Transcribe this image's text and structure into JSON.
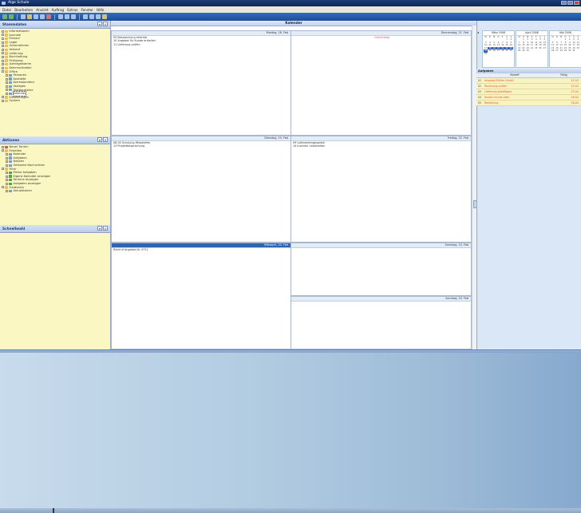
{
  "window": {
    "title": "Alge Schule"
  },
  "menu": [
    "Datei",
    "Bearbeiten",
    "Ansicht",
    "Auftrag",
    "Extras",
    "Fenster",
    "Hilfe"
  ],
  "panels": {
    "navigation": {
      "title": "Stammdaten",
      "items": [
        {
          "label": "Informationen",
          "level": 0,
          "icon": "folder"
        },
        {
          "label": "Journale",
          "level": 0,
          "icon": "folder"
        },
        {
          "label": "Einkauf",
          "level": 0,
          "icon": "folder"
        },
        {
          "label": "Lager",
          "level": 0,
          "icon": "folder"
        },
        {
          "label": "Unternehmen",
          "level": 0,
          "icon": "folder"
        },
        {
          "label": "Verkauf",
          "level": 0,
          "icon": "folder"
        },
        {
          "label": "Lieferung",
          "level": 0,
          "icon": "folder"
        },
        {
          "label": "Buchhaltung",
          "level": 0,
          "icon": "folder"
        },
        {
          "label": "Fertigung",
          "level": 0,
          "icon": "folder"
        },
        {
          "label": "Auftragsstamm",
          "level": 0,
          "icon": "folder"
        },
        {
          "label": "Kommunikation",
          "level": 0,
          "icon": "folder"
        },
        {
          "label": "Office",
          "level": 0,
          "icon": "folder"
        },
        {
          "label": "Personen",
          "level": 1,
          "icon": "doc"
        },
        {
          "label": "Kontakte",
          "level": 1,
          "icon": "doc"
        },
        {
          "label": "Korrespondenz",
          "level": 1,
          "icon": "doc"
        },
        {
          "label": "Vorlagen",
          "level": 1,
          "icon": "doc"
        },
        {
          "label": "Textbausteine",
          "level": 1,
          "icon": "doc"
        },
        {
          "label": "Kalender",
          "level": 1,
          "icon": "doc",
          "selected": true
        },
        {
          "label": "Einstellungen",
          "level": 0,
          "icon": "folder"
        },
        {
          "label": "System",
          "level": 0,
          "icon": "folder"
        }
      ]
    },
    "actions": {
      "title": "Aktionen",
      "items": [
        {
          "label": "Neuer Termin",
          "level": 0,
          "icon": "red"
        },
        {
          "label": "Erstellen",
          "level": 0,
          "icon": "folder"
        },
        {
          "label": "Kalender",
          "level": 1,
          "icon": "doc"
        },
        {
          "label": "Aufgaben",
          "level": 1,
          "icon": "doc"
        },
        {
          "label": "Notizen",
          "level": 1,
          "icon": "doc"
        },
        {
          "label": "Gelesene Nachrichten",
          "level": 1,
          "icon": "doc"
        },
        {
          "label": "Filter",
          "level": 0,
          "icon": "folder"
        },
        {
          "label": "Meine Aufgaben",
          "level": 1,
          "icon": "grn"
        },
        {
          "label": "Eigene Kalender anzeigen",
          "level": 1,
          "icon": "grn"
        },
        {
          "label": "Termine anzeigen",
          "level": 1,
          "icon": "grn"
        },
        {
          "label": "Aufgaben anzeigen",
          "level": 1,
          "icon": "grn"
        },
        {
          "label": "Zusätzlich",
          "level": 0,
          "icon": "folder"
        },
        {
          "label": "Aktualisieren",
          "level": 1,
          "icon": "doc"
        }
      ]
    },
    "shortcuts": {
      "title": "Schnellwahl"
    }
  },
  "calendar": {
    "title": "Kalender",
    "days": [
      {
        "label": "Montag, 18. Feb",
        "entries": [
          "09 Besprechung Vertrieb",
          "10 Angebot für Kunde erstellen",
          "11 Lieferung prüfen"
        ],
        "today": false
      },
      {
        "label": "Donnerstag, 21. Feb",
        "entries": [
          "Geburtstag"
        ],
        "red": true,
        "today": false
      },
      {
        "label": "Dienstag, 19. Feb",
        "entries": [
          "08:30 Schulung Mitarbeiter",
          "13 Projektbesprechung"
        ],
        "today": false
      },
      {
        "label": "Freitag, 22. Feb",
        "entries": [
          "09 Lieferantengespräch",
          "14 Inventur vorbereiten"
        ],
        "today": false
      },
      {
        "label": "Mittwoch, 20. Feb",
        "entries": [
          "Rückruf Angebot Nr. 4711"
        ],
        "today": true
      },
      {
        "label": "Samstag, 23. Feb",
        "entries": [],
        "today": false
      },
      {
        "label": "Sonntag, 24. Feb",
        "entries": [],
        "today": false
      }
    ]
  },
  "minicals": [
    {
      "label": "März 2008",
      "weekdays": [
        "M",
        "D",
        "M",
        "D",
        "F",
        "S",
        "S"
      ],
      "days": [
        "",
        "",
        "",
        "",
        "",
        "1",
        "2",
        "3",
        "4",
        "5",
        "6",
        "7",
        "8",
        "9",
        "10",
        "11",
        "12",
        "13",
        "14",
        "15",
        "16",
        "17",
        "18",
        "19",
        "20",
        "21",
        "22",
        "23",
        "24",
        "25",
        "26",
        "27",
        "28",
        "29",
        "30",
        "31"
      ],
      "highlight": [
        "18",
        "19",
        "20",
        "21",
        "22",
        "23",
        "24"
      ]
    },
    {
      "label": "April 2008",
      "weekdays": [
        "M",
        "D",
        "M",
        "D",
        "F",
        "S",
        "S"
      ],
      "days": [
        "",
        "1",
        "2",
        "3",
        "4",
        "5",
        "6",
        "7",
        "8",
        "9",
        "10",
        "11",
        "12",
        "13",
        "14",
        "15",
        "16",
        "17",
        "18",
        "19",
        "20",
        "21",
        "22",
        "23",
        "24",
        "25",
        "26",
        "27",
        "28",
        "29",
        "30"
      ],
      "highlight": []
    },
    {
      "label": "Mai 2008",
      "weekdays": [
        "M",
        "D",
        "M",
        "D",
        "F",
        "S",
        "S"
      ],
      "days": [
        "",
        "",
        "",
        "1",
        "2",
        "3",
        "4",
        "5",
        "6",
        "7",
        "8",
        "9",
        "10",
        "11",
        "12",
        "13",
        "14",
        "15",
        "16",
        "17",
        "18",
        "19",
        "20",
        "21",
        "22",
        "23",
        "24",
        "25",
        "26",
        "27",
        "28",
        "29",
        "30",
        "31"
      ],
      "highlight": []
    }
  ],
  "tasks": {
    "title": "Aufgaben",
    "columns": [
      "",
      "Betreff",
      "Fällig"
    ],
    "rows": [
      {
        "num": "01",
        "subject": "Angebot Müller GmbH",
        "due": "21.02."
      },
      {
        "num": "02",
        "subject": "Rechnung prüfen",
        "due": "22.02."
      },
      {
        "num": "03",
        "subject": "Lieferung bestätigen",
        "due": "25.02."
      },
      {
        "num": "04",
        "subject": "Kunde zurückrufen",
        "due": "26.02."
      },
      {
        "num": "05",
        "subject": "Bestellung",
        "due": "28.02."
      }
    ]
  }
}
